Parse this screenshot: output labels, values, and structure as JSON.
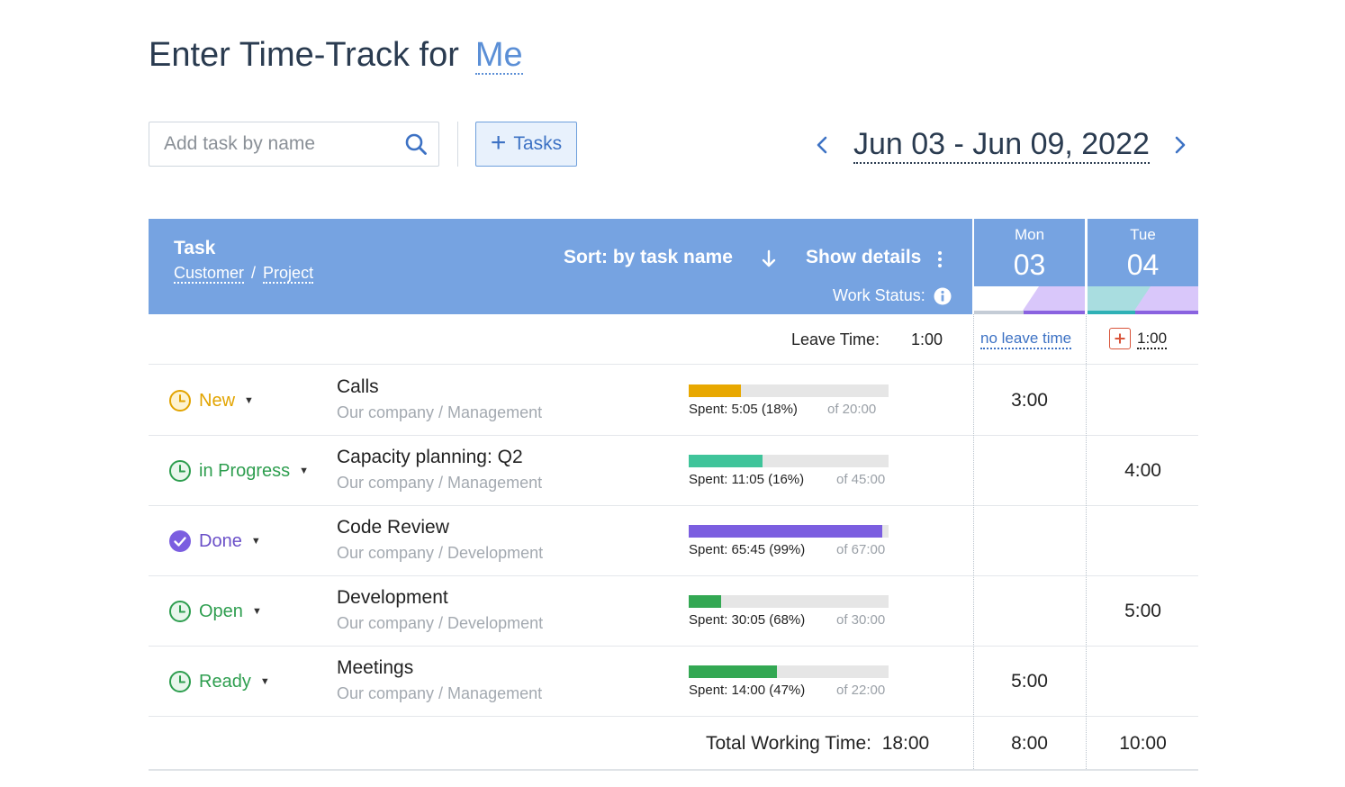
{
  "page": {
    "title_prefix": "Enter Time-Track for",
    "title_user": "Me"
  },
  "toolbar": {
    "search_placeholder": "Add task by name",
    "add_tasks_label": "Tasks",
    "date_range": "Jun 03 - Jun 09, 2022"
  },
  "header": {
    "task_label": "Task",
    "customer_label": "Customer",
    "separator": "/",
    "project_label": "Project",
    "sort_label": "Sort: by task name",
    "show_details_label": "Show details",
    "work_status_label": "Work Status:"
  },
  "days": [
    {
      "name": "Mon",
      "num": "03",
      "leave": "no leave time",
      "total": "8:00"
    },
    {
      "name": "Tue",
      "num": "04",
      "leave": "1:00",
      "total": "10:00"
    }
  ],
  "leave": {
    "label": "Leave Time:",
    "total": "1:00"
  },
  "tasks": [
    {
      "status": "New",
      "status_color": "#e2a400",
      "icon": "clock-icon",
      "name": "Calls",
      "path": "Our company / Management",
      "spent": "Spent: 5:05 (18%)",
      "of": "of 20:00",
      "progress": 0.26,
      "bar_color": "#e8a800",
      "mon": "3:00",
      "tue": ""
    },
    {
      "status": "in Progress",
      "status_color": "#2e9e4f",
      "icon": "clock-icon",
      "name": "Capacity planning: Q2",
      "path": "Our company / Management",
      "spent": "Spent: 11:05 (16%)",
      "of": "of 45:00",
      "progress": 0.37,
      "bar_color": "#3fc49a",
      "mon": "",
      "tue": "4:00"
    },
    {
      "status": "Done",
      "status_color": "#6a4fc8",
      "icon": "check-circle-icon",
      "name": "Code Review",
      "path": "Our company / Development",
      "spent": "Spent: 65:45 (99%)",
      "of": "of 67:00",
      "progress": 0.97,
      "bar_color": "#7b5ee0",
      "mon": "",
      "tue": ""
    },
    {
      "status": "Open",
      "status_color": "#2e9e4f",
      "icon": "clock-icon",
      "name": "Development",
      "path": "Our company / Development",
      "spent": "Spent: 30:05 (68%)",
      "of": "of 30:00",
      "progress": 0.16,
      "bar_color": "#33a853",
      "mon": "",
      "tue": "5:00"
    },
    {
      "status": "Ready",
      "status_color": "#2e9e4f",
      "icon": "clock-icon",
      "name": "Meetings",
      "path": "Our company / Management",
      "spent": "Spent: 14:00 (47%)",
      "of": "of 22:00",
      "progress": 0.44,
      "bar_color": "#33a853",
      "mon": "5:00",
      "tue": ""
    }
  ],
  "totals": {
    "label": "Total Working Time:",
    "value": "18:00"
  }
}
